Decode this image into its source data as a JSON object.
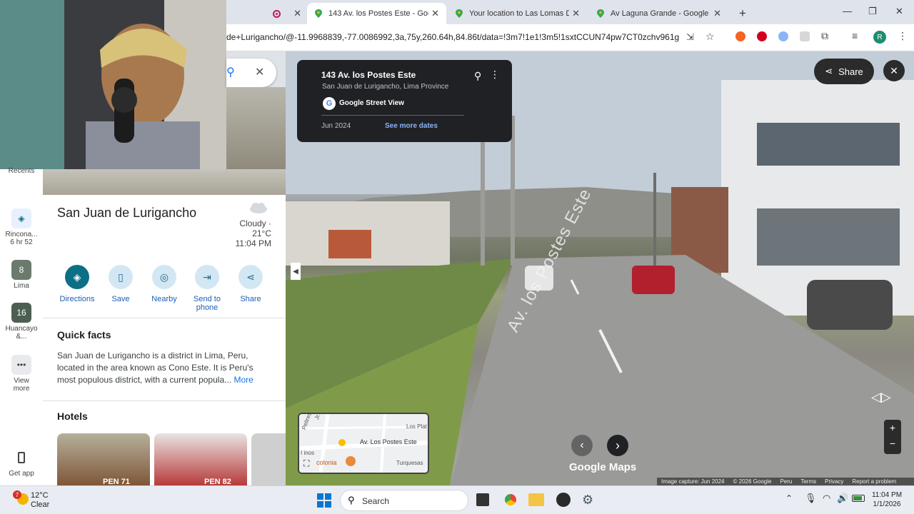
{
  "browser": {
    "tabs": [
      {
        "label": "",
        "icon": "record-icon"
      },
      {
        "label": "143 Av. los Postes Este - Googl",
        "icon": "maps-pin-icon",
        "active": true
      },
      {
        "label": "Your location to Las Lomas De",
        "icon": "maps-pin-icon"
      },
      {
        "label": "Av Laguna Grande - Google Ma",
        "icon": "maps-pin-icon"
      }
    ],
    "url": "de+Lurigancho/@-11.9968839,-77.0086992,3a,75y,260.64h,84.86t/data=!3m7!1e1!3m5!1sxtCCUN74pw7CT0zchv961g!2e...",
    "profile_initial": "R"
  },
  "rail": {
    "recents": "Recents",
    "items": [
      {
        "label": "Rincona...",
        "sub": "6 hr 52"
      },
      {
        "label": "Lima",
        "badge": "8"
      },
      {
        "label": "Huancayo &...",
        "badge": "16"
      },
      {
        "label": "View more"
      }
    ],
    "get_app": "Get app"
  },
  "panel": {
    "title": "San Juan de Lurigancho",
    "weather": {
      "condition": "Cloudy ·",
      "temp": "21°C",
      "time": "11:04 PM"
    },
    "actions": {
      "directions": "Directions",
      "save": "Save",
      "nearby": "Nearby",
      "send": "Send to phone",
      "share": "Share"
    },
    "quick_facts_heading": "Quick facts",
    "quick_facts_text": "San Juan de Lurigancho is a district in Lima, Peru, located in the area known as Cono Este. It is Peru's most populous district, with a current popula...",
    "more_link": "More",
    "hotels_heading": "Hotels",
    "hotel_prices": [
      "PEN 71",
      "PEN 82"
    ]
  },
  "streetview": {
    "address": "143 Av. los Postes Este",
    "locality": "San Juan de Lurigancho, Lima Province",
    "brand": "Google Street View",
    "date": "Jun 2024",
    "more_dates": "See more dates",
    "share": "Share",
    "road_text": "Av. los Postes Este",
    "watermark": "Google Maps",
    "minimap": {
      "labels": [
        "Jr. Saltre",
        "Los Plat",
        "Peltres",
        "Av. Los Postes Este",
        "I inos",
        "Turquesas",
        "colonia"
      ]
    },
    "footer": [
      "Image capture: Jun 2024",
      "© 2026 Google",
      "Peru",
      "Terms",
      "Privacy",
      "Report a problem"
    ]
  },
  "taskbar": {
    "weather_temp": "12°C",
    "weather_desc": "Clear",
    "weather_badge": "7",
    "search": "Search",
    "time": "11:04 PM",
    "date": "1/1/2026"
  }
}
